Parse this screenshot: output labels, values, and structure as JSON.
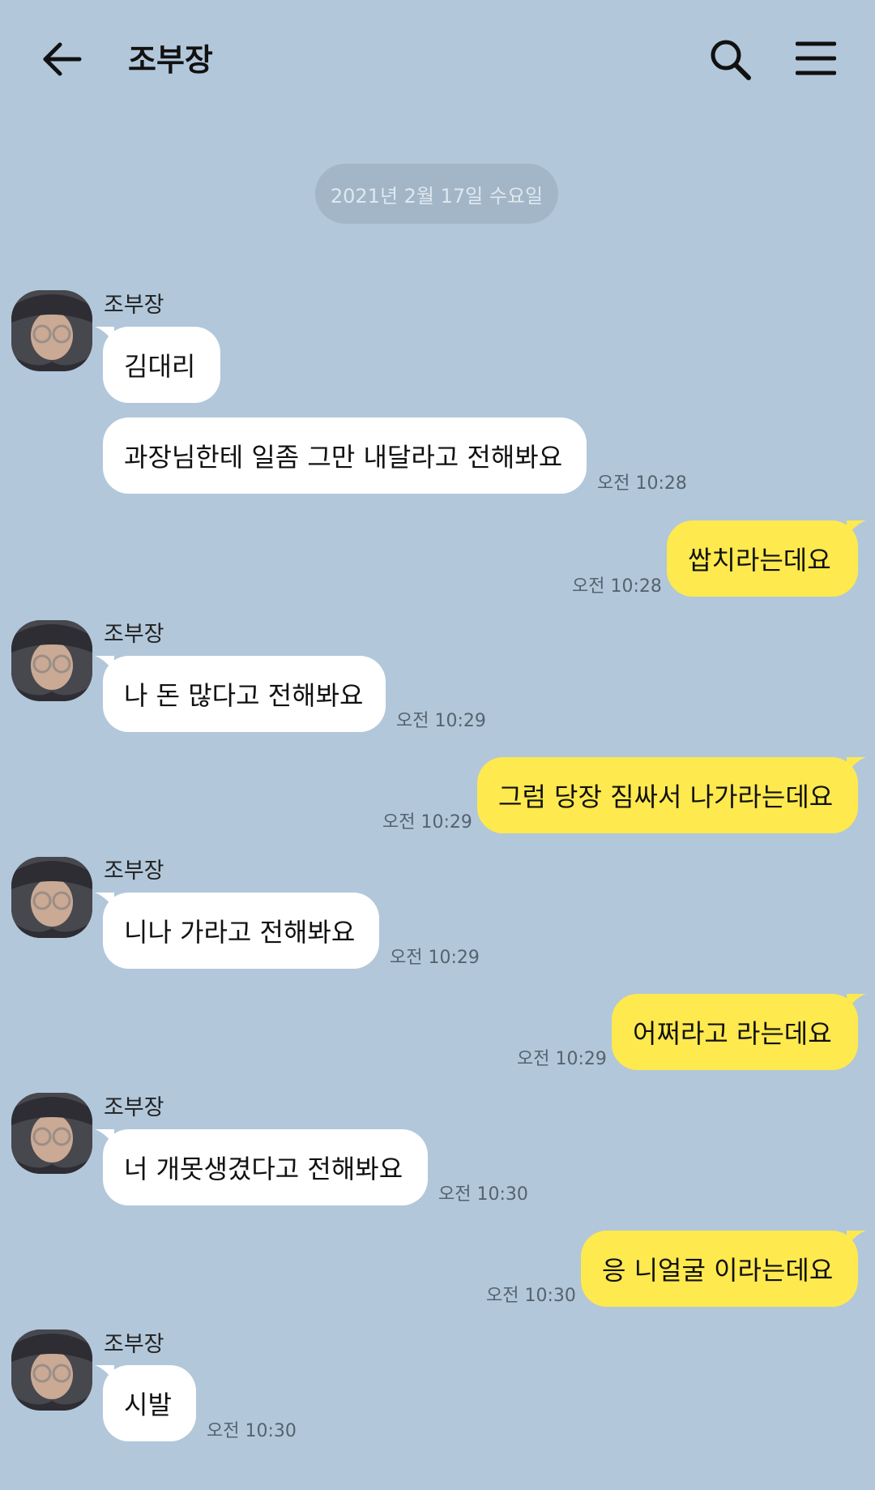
{
  "header": {
    "title": "조부장"
  },
  "date_divider": "2021년 2월 17일 수요일",
  "messages": [
    {
      "from": "other",
      "sender": "조부장",
      "text": "김대리",
      "time": ""
    },
    {
      "from": "other",
      "sender": "",
      "text": "과장님한테 일좀 그만 내달라고 전해봐요",
      "time": "오전 10:28"
    },
    {
      "from": "me",
      "text": "쌉치라는데요",
      "time": "오전 10:28"
    },
    {
      "from": "other",
      "sender": "조부장",
      "text": "나 돈 많다고 전해봐요",
      "time": "오전 10:29"
    },
    {
      "from": "me",
      "text": "그럼 당장 짐싸서 나가라는데요",
      "time": "오전 10:29"
    },
    {
      "from": "other",
      "sender": "조부장",
      "text": "니나 가라고 전해봐요",
      "time": "오전 10:29"
    },
    {
      "from": "me",
      "text": "어쩌라고 라는데요",
      "time": "오전 10:29"
    },
    {
      "from": "other",
      "sender": "조부장",
      "text": "너 개못생겼다고 전해봐요",
      "time": "오전 10:30"
    },
    {
      "from": "me",
      "text": "응 니얼굴 이라는데요",
      "time": "오전 10:30"
    },
    {
      "from": "other",
      "sender": "조부장",
      "text": "시발",
      "time": "오전 10:30"
    }
  ],
  "icons": {
    "back": "arrow-left-icon",
    "search": "search-icon",
    "menu": "hamburger-menu-icon"
  },
  "colors": {
    "background": "#b2c7da",
    "my_bubble": "#fee94e",
    "other_bubble": "#ffffff",
    "date_pill": "#a3b6c7"
  }
}
